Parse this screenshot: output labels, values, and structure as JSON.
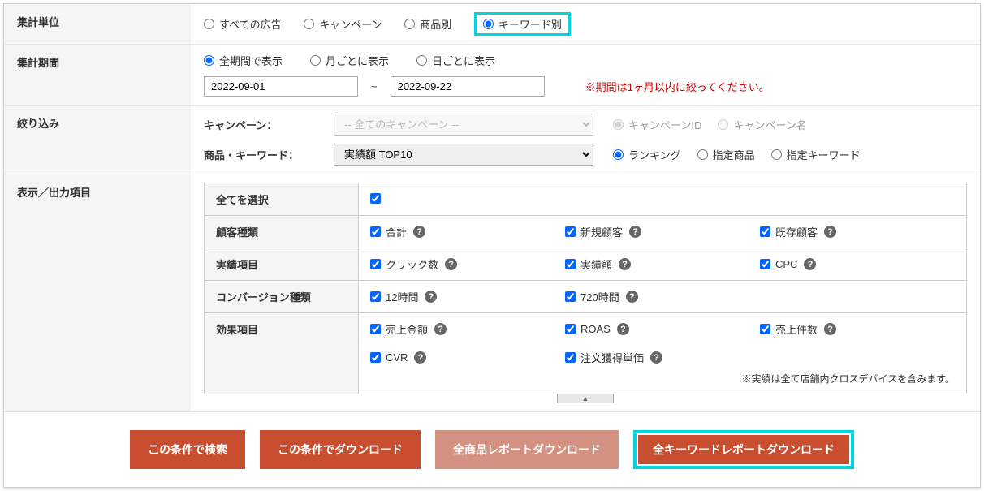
{
  "labels": {
    "unit": "集計単位",
    "period": "集計期間",
    "filter": "絞り込み",
    "output": "表示／出力項目"
  },
  "unit": {
    "all_ads": "すべての広告",
    "campaign": "キャンペーン",
    "by_product": "商品別",
    "by_keyword": "キーワード別"
  },
  "period": {
    "all": "全期間で表示",
    "monthly": "月ごとに表示",
    "daily": "日ごとに表示",
    "from": "2022-09-01",
    "to": "2022-09-22",
    "warn": "※期間は1ヶ月以内に絞ってください。"
  },
  "filter": {
    "campaign_label": "キャンペーン：",
    "campaign_placeholder": "-- 全てのキャンペーン --",
    "campaign_id": "キャンペーンID",
    "campaign_name": "キャンペーン名",
    "product_keyword_label": "商品・キーワード：",
    "keyword_value": "実績額 TOP10",
    "ranking": "ランキング",
    "specified_product": "指定商品",
    "specified_keyword": "指定キーワード"
  },
  "output": {
    "select_all": "全てを選択",
    "customer_type": "顧客種類",
    "customer_total": "合計",
    "customer_new": "新規顧客",
    "customer_existing": "既存顧客",
    "performance": "実績項目",
    "clicks": "クリック数",
    "performance_amount": "実績額",
    "cpc": "CPC",
    "conversion_type": "コンバージョン種類",
    "hours_12": "12時間",
    "hours_720": "720時間",
    "effect": "効果項目",
    "sales": "売上金額",
    "roas": "ROAS",
    "sales_count": "売上件数",
    "cvr": "CVR",
    "order_unit_price": "注文獲得単価",
    "note": "※実績は全て店舗内クロスデバイスを含みます。"
  },
  "buttons": {
    "search": "この条件で検索",
    "download": "この条件でダウンロード",
    "all_products": "全商品レポートダウンロード",
    "all_keywords": "全キーワードレポートダウンロード"
  }
}
